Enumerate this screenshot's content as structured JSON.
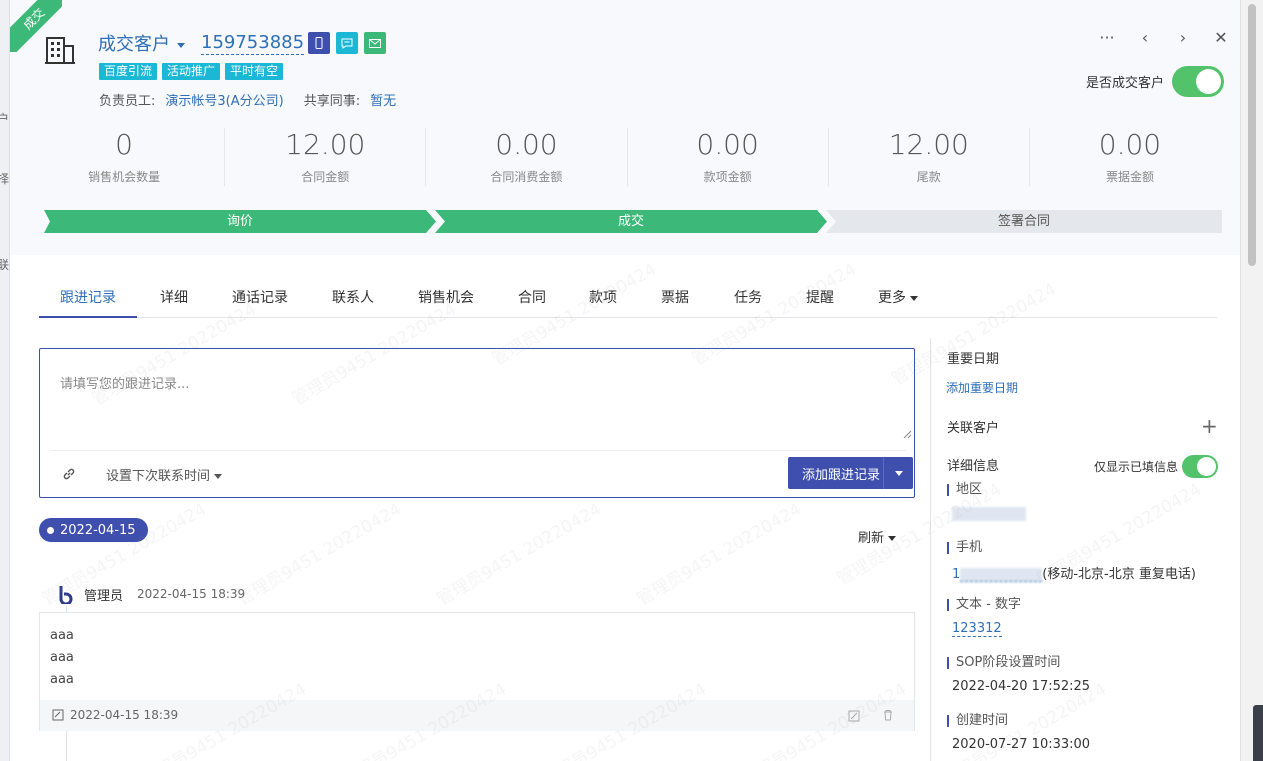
{
  "left_strip": [
    "户",
    "择",
    "联"
  ],
  "ribbon": "成交",
  "header": {
    "customer_type": "成交客户",
    "customer_id": "159753885",
    "tags": [
      "百度引流",
      "活动推广",
      "平时有空"
    ],
    "owner_label": "负责员工:",
    "owner_value": "演示帐号3(A分公司)",
    "share_label": "共享同事:",
    "share_value": "暂无",
    "deal_switch_label": "是否成交客户",
    "controls": [
      "···",
      "‹",
      "›",
      "✕"
    ]
  },
  "stats": [
    {
      "value": "0",
      "caption": "销售机会数量"
    },
    {
      "value": "12.00",
      "caption": "合同金额"
    },
    {
      "value": "0.00",
      "caption": "合同消费金额"
    },
    {
      "value": "0.00",
      "caption": "款项金额"
    },
    {
      "value": "12.00",
      "caption": "尾款"
    },
    {
      "value": "0.00",
      "caption": "票据金额"
    }
  ],
  "stages": [
    "询价",
    "成交",
    "签署合同"
  ],
  "tabs": [
    "跟进记录",
    "详细",
    "通话记录",
    "联系人",
    "销售机会",
    "合同",
    "款项",
    "票据",
    "任务",
    "提醒",
    "更多"
  ],
  "editor": {
    "placeholder": "请填写您的跟进记录...",
    "next_contact": "设置下次联系时间",
    "add_button": "添加跟进记录"
  },
  "timeline": {
    "date": "2022-04-15",
    "refresh": "刷新",
    "record": {
      "author": "管理员",
      "time": "2022-04-15 18:39",
      "lines": [
        "aaa",
        "aaa",
        "aaa"
      ],
      "footer_time": "2022-04-15 18:39"
    }
  },
  "side": {
    "important_dates": "重要日期",
    "add_important_date": "添加重要日期",
    "related_customer": "关联客户",
    "detail_info": "详细信息",
    "only_filled": "仅显示已填信息",
    "fields": [
      {
        "label": "地区",
        "value": ""
      },
      {
        "label": "手机",
        "prefix": "1",
        "value": "(移动-北京-北京 重复电话)"
      },
      {
        "label": "文本 - 数字",
        "value": "123312"
      },
      {
        "label": "SOP阶段设置时间",
        "value": "2022-04-20 17:52:25"
      },
      {
        "label": "创建时间",
        "value": "2020-07-27 10:33:00"
      }
    ]
  },
  "watermark": "管理员9451 20220424",
  "colors": {
    "primary": "#3e4fae",
    "link": "#2f6fb8",
    "stage_done": "#3cb878",
    "stage_todo": "#e4e7eb",
    "tag": "#1bb8d6",
    "toggle_on": "#52c36a"
  }
}
